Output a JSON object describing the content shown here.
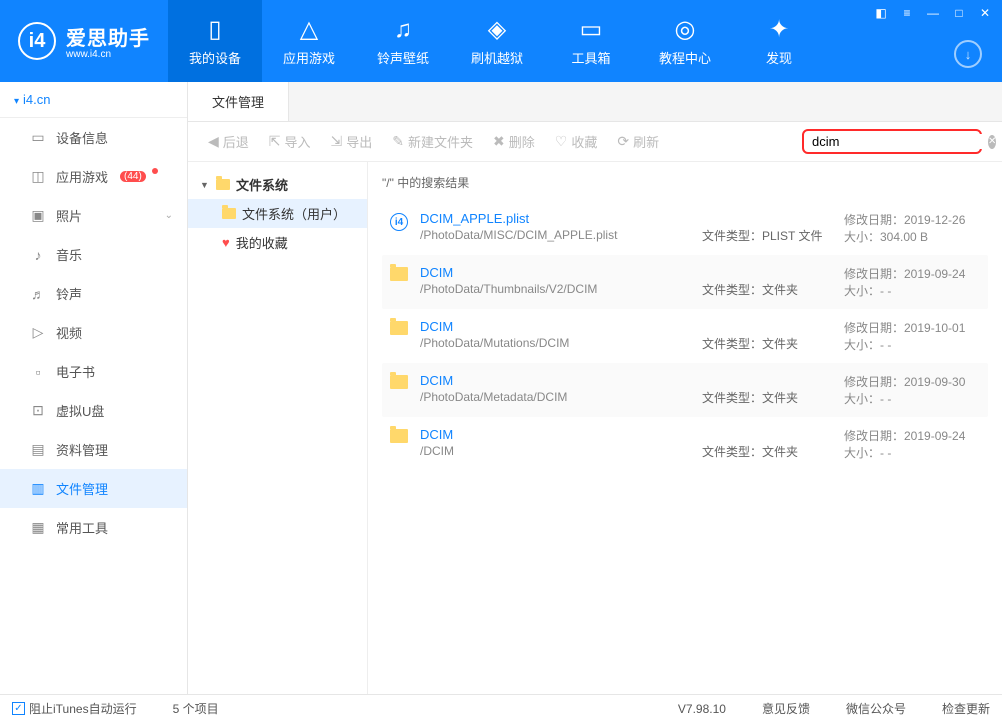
{
  "logo": {
    "char": "i4",
    "title": "爱思助手",
    "sub": "www.i4.cn"
  },
  "topnav": [
    {
      "label": "我的设备"
    },
    {
      "label": "应用游戏"
    },
    {
      "label": "铃声壁纸"
    },
    {
      "label": "刷机越狱"
    },
    {
      "label": "工具箱"
    },
    {
      "label": "教程中心"
    },
    {
      "label": "发现"
    }
  ],
  "sidebar": {
    "root": "i4.cn",
    "items": [
      {
        "label": "设备信息"
      },
      {
        "label": "应用游戏",
        "badge": "44"
      },
      {
        "label": "照片",
        "chev": true
      },
      {
        "label": "音乐"
      },
      {
        "label": "铃声"
      },
      {
        "label": "视频"
      },
      {
        "label": "电子书"
      },
      {
        "label": "虚拟U盘"
      },
      {
        "label": "资料管理"
      },
      {
        "label": "文件管理"
      },
      {
        "label": "常用工具"
      }
    ]
  },
  "tabs": {
    "current": "文件管理"
  },
  "toolbar": [
    {
      "label": "后退"
    },
    {
      "label": "导入"
    },
    {
      "label": "导出"
    },
    {
      "label": "新建文件夹"
    },
    {
      "label": "删除"
    },
    {
      "label": "收藏"
    },
    {
      "label": "刷新"
    }
  ],
  "search": {
    "value": "dcim"
  },
  "tree": [
    {
      "label": "文件系统",
      "root": true
    },
    {
      "label": "文件系统（用户）",
      "selected": true
    },
    {
      "label": "我的收藏",
      "heart": true
    }
  ],
  "results_header": "\"/\" 中的搜索结果",
  "label_modified": "修改日期：",
  "label_size": "大小：",
  "label_type": "文件类型：",
  "results": [
    {
      "name": "DCIM_APPLE.plist",
      "path": "/PhotoData/MISC/DCIM_APPLE.plist",
      "type": "PLIST 文件",
      "modified": "2019-12-26",
      "size": "304.00 B",
      "plist": true
    },
    {
      "name": "DCIM",
      "path": "/PhotoData/Thumbnails/V2/DCIM",
      "type": "文件夹",
      "modified": "2019-09-24",
      "size": "- -"
    },
    {
      "name": "DCIM",
      "path": "/PhotoData/Mutations/DCIM",
      "type": "文件夹",
      "modified": "2019-10-01",
      "size": "- -"
    },
    {
      "name": "DCIM",
      "path": "/PhotoData/Metadata/DCIM",
      "type": "文件夹",
      "modified": "2019-09-30",
      "size": "- -"
    },
    {
      "name": "DCIM",
      "path": "/DCIM",
      "type": "文件夹",
      "modified": "2019-09-24",
      "size": "- -"
    }
  ],
  "statusbar": {
    "check_label": "阻止iTunes自动运行",
    "count": "5 个项目",
    "version": "V7.98.10",
    "links": [
      "意见反馈",
      "微信公众号",
      "检查更新"
    ]
  }
}
